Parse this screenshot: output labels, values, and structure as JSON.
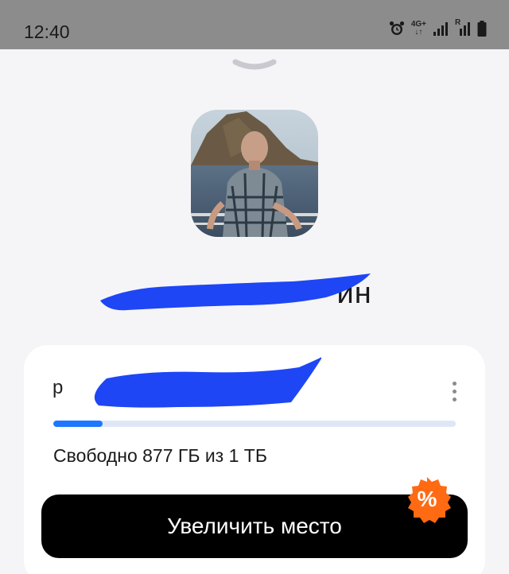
{
  "status_bar": {
    "time": "12:40",
    "network": "4G+",
    "roaming": "R",
    "icons": [
      "alarm-icon",
      "network-4g-icon",
      "signal-icon",
      "roaming-signal-icon",
      "battery-icon"
    ]
  },
  "profile": {
    "name_visible_fragment": "ин",
    "avatar": "user-photo"
  },
  "account": {
    "email_visible_fragment": "p",
    "storage_free_text": "Свободно 877 ГБ из 1 ТБ",
    "storage_used_fraction": 0.123,
    "more_icon": "more-vertical-icon"
  },
  "actions": {
    "increase_storage_label": "Увеличить место",
    "promo_badge": "%"
  },
  "colors": {
    "progress_fill": "#1e78ff",
    "progress_track": "#dfe7f7",
    "promo_badge": "#ff6a13",
    "redaction": "#1e46f5",
    "cta_background": "#000000"
  }
}
